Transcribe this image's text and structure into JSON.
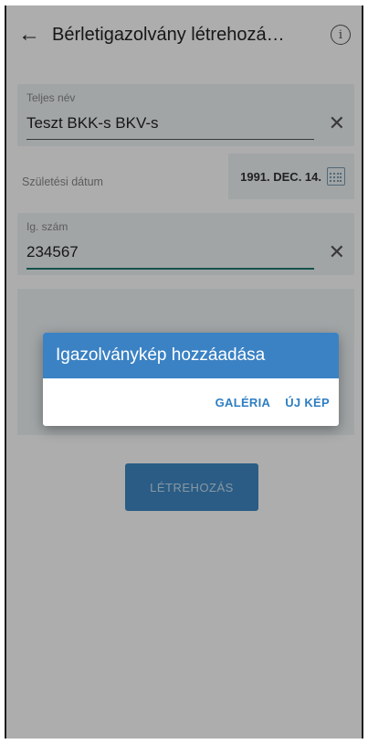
{
  "appbar": {
    "back_icon": "←",
    "title": "Bérletigazolvány létrehozá…",
    "info_icon": "i"
  },
  "form": {
    "full_name": {
      "label": "Teljes név",
      "value": "Teszt BKK-s BKV-s"
    },
    "birth_date": {
      "label": "Születési dátum",
      "value": "1991. DEC. 14."
    },
    "id_number": {
      "label": "Ig. szám",
      "value": "234567"
    },
    "create_button": "LÉTREHOZÁS"
  },
  "dialog": {
    "title": "Igazolványkép hozzáadása",
    "gallery": "GALÉRIA",
    "new_photo": "ÚJ KÉP"
  },
  "colors": {
    "accent": "#3b82c4",
    "field_bg": "#eef3f5"
  }
}
